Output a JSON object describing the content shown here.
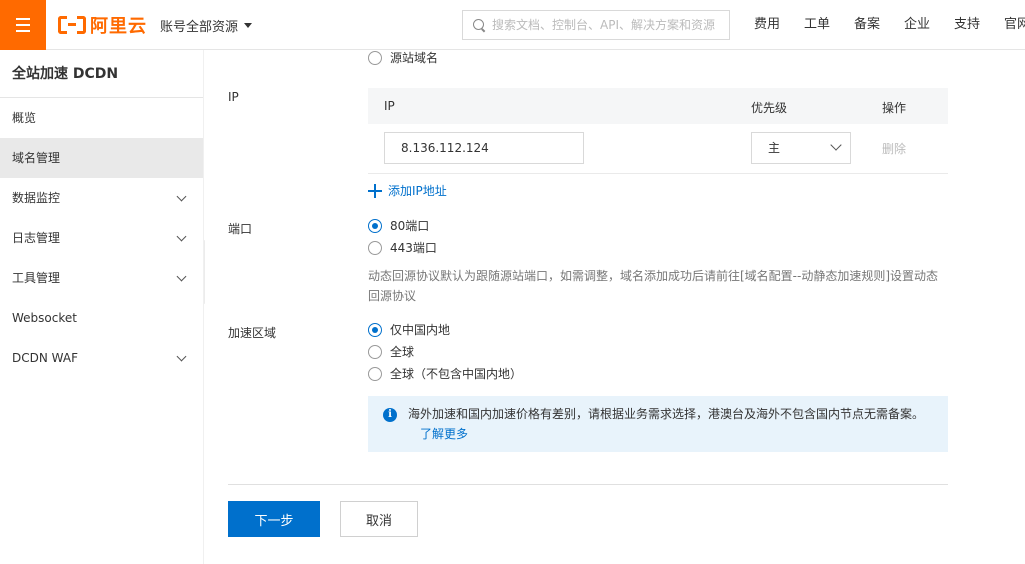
{
  "header": {
    "logo_text": "阿里云",
    "account_label": "账号全部资源",
    "search_placeholder": "搜索文档、控制台、API、解决方案和资源",
    "nav": [
      "费用",
      "工单",
      "备案",
      "企业",
      "支持",
      "官网"
    ]
  },
  "sidebar": {
    "title": "全站加速 DCDN",
    "items": [
      {
        "label": "概览",
        "expandable": false,
        "active": false
      },
      {
        "label": "域名管理",
        "expandable": false,
        "active": true
      },
      {
        "label": "数据监控",
        "expandable": true,
        "active": false
      },
      {
        "label": "日志管理",
        "expandable": true,
        "active": false
      },
      {
        "label": "工具管理",
        "expandable": true,
        "active": false
      },
      {
        "label": "Websocket",
        "expandable": false,
        "active": false
      },
      {
        "label": "DCDN WAF",
        "expandable": true,
        "active": false
      }
    ]
  },
  "form": {
    "source_type_option": "源站域名",
    "ip_label": "IP",
    "ip_table": {
      "headers": [
        "IP",
        "优先级",
        "操作"
      ],
      "rows": [
        {
          "ip": "8.136.112.124",
          "priority": "主",
          "action": "删除"
        }
      ]
    },
    "add_ip_label": "添加IP地址",
    "port_label": "端口",
    "port_options": [
      {
        "label": "80端口",
        "checked": true
      },
      {
        "label": "443端口",
        "checked": false
      }
    ],
    "port_help": "动态回源协议默认为跟随源站端口，如需调整，域名添加成功后请前往[域名配置--动静态加速规则]设置动态回源协议",
    "region_label": "加速区域",
    "region_options": [
      {
        "label": "仅中国内地",
        "checked": true
      },
      {
        "label": "全球",
        "checked": false
      },
      {
        "label": "全球（不包含中国内地）",
        "checked": false
      }
    ],
    "notice_text": "海外加速和国内加速价格有差别，请根据业务需求选择，港澳台及海外不包含国内节点无需备案。",
    "notice_link": "了解更多",
    "next_button": "下一步",
    "cancel_button": "取消"
  },
  "colors": {
    "brand": "#ff6a00",
    "primary": "#0070cc",
    "notice_bg": "#e8f3fb"
  }
}
